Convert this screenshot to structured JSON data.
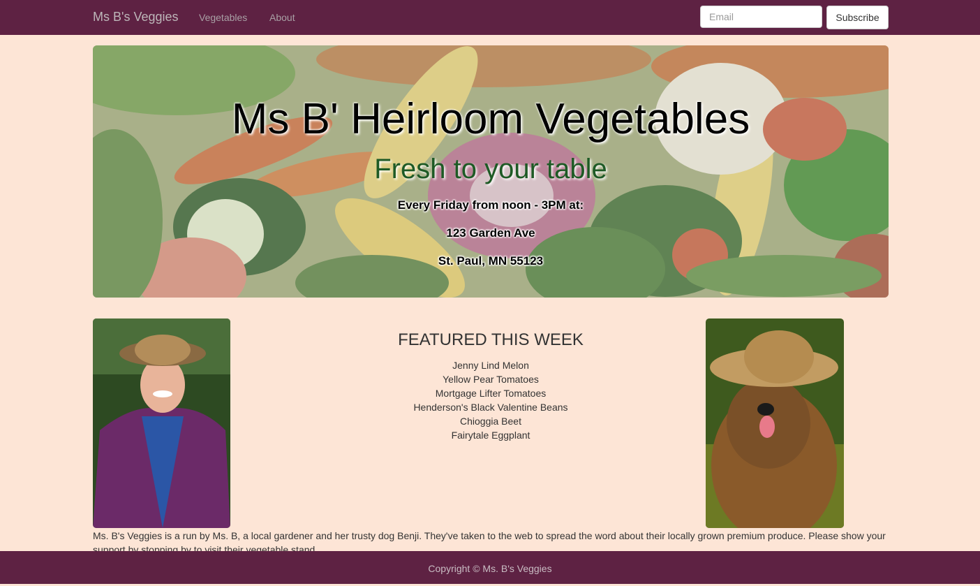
{
  "navbar": {
    "brand": "Ms B's Veggies",
    "links": [
      "Vegetables",
      "About"
    ],
    "email_placeholder": "Email",
    "subscribe_label": "Subscribe"
  },
  "hero": {
    "title": "Ms B' Heirloom Vegetables",
    "subtitle": "Fresh to your table",
    "schedule": "Every Friday from noon - 3PM at:",
    "address1": "123 Garden Ave",
    "address2": "St. Paul, MN 55123"
  },
  "featured": {
    "heading": "FEATURED THIS WEEK",
    "items": [
      "Jenny Lind Melon",
      "Yellow Pear Tomatoes",
      "Mortgage Lifter Tomatoes",
      "Henderson's Black Valentine Beans",
      "Chioggia Beet",
      "Fairytale Eggplant"
    ]
  },
  "about": "Ms. B's Veggies is a run by Ms. B, a local gardener and her trusty dog Benji. They've taken to the web to spread the word about their locally grown premium produce. Please show your support by stopping by to visit their vegetable stand.",
  "footer": "Copyright © Ms. B's Veggies",
  "colors": {
    "nav_bg": "#5e2243",
    "page_bg": "#fde5d6",
    "subtitle_green": "#1e5a25"
  }
}
